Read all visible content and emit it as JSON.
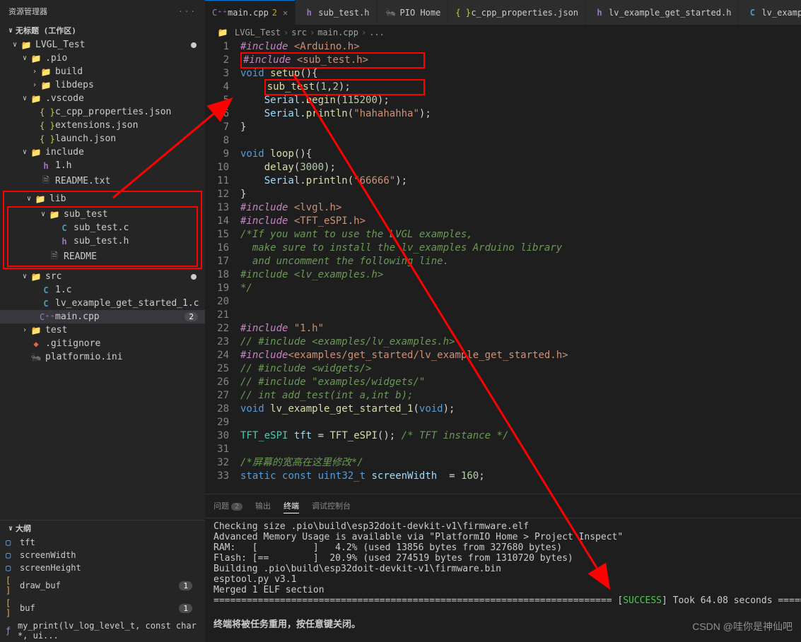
{
  "sidebar": {
    "title": "资源管理器",
    "workspace": "无标题 (工作区)",
    "tree": [
      {
        "indent": 1,
        "chev": "v",
        "icon": "folder-root",
        "label": "LVGL_Test",
        "dot": true
      },
      {
        "indent": 2,
        "chev": "v",
        "icon": "folder",
        "label": ".pio"
      },
      {
        "indent": 3,
        "chev": ">",
        "icon": "folder",
        "label": "build"
      },
      {
        "indent": 3,
        "chev": ">",
        "icon": "folder",
        "label": "libdeps"
      },
      {
        "indent": 2,
        "chev": "v",
        "icon": "folder",
        "label": ".vscode"
      },
      {
        "indent": 3,
        "chev": "",
        "icon": "json",
        "label": "c_cpp_properties.json"
      },
      {
        "indent": 3,
        "chev": "",
        "icon": "json",
        "label": "extensions.json"
      },
      {
        "indent": 3,
        "chev": "",
        "icon": "json",
        "label": "launch.json"
      },
      {
        "indent": 2,
        "chev": "v",
        "icon": "folder",
        "label": "include"
      },
      {
        "indent": 3,
        "chev": "",
        "icon": "h",
        "label": "1.h"
      },
      {
        "indent": 3,
        "chev": "",
        "icon": "txt",
        "label": "README.txt"
      },
      {
        "indent": 2,
        "chev": "v",
        "icon": "folder",
        "label": "lib",
        "redStart": true
      },
      {
        "indent": 3,
        "chev": "v",
        "icon": "folder",
        "label": "sub_test"
      },
      {
        "indent": 4,
        "chev": "",
        "icon": "c",
        "label": "sub_test.c"
      },
      {
        "indent": 4,
        "chev": "",
        "icon": "h",
        "label": "sub_test.h"
      },
      {
        "indent": 3,
        "chev": "",
        "icon": "txt",
        "label": "README",
        "redEnd": true
      },
      {
        "indent": 2,
        "chev": "v",
        "icon": "folder",
        "label": "src",
        "dot": true
      },
      {
        "indent": 3,
        "chev": "",
        "icon": "c",
        "label": "1.c"
      },
      {
        "indent": 3,
        "chev": "",
        "icon": "c",
        "label": "lv_example_get_started_1.c"
      },
      {
        "indent": 3,
        "chev": "",
        "icon": "cpp",
        "label": "main.cpp",
        "active": true,
        "badge": "2"
      },
      {
        "indent": 2,
        "chev": ">",
        "icon": "folder",
        "label": "test"
      },
      {
        "indent": 2,
        "chev": "",
        "icon": "git",
        "label": ".gitignore"
      },
      {
        "indent": 2,
        "chev": "",
        "icon": "pio",
        "label": "platformio.ini"
      }
    ],
    "outline_title": "大纲",
    "outline": [
      {
        "icon": "var",
        "label": "tft"
      },
      {
        "icon": "var",
        "label": "screenWidth"
      },
      {
        "icon": "var",
        "label": "screenHeight"
      },
      {
        "icon": "arr",
        "label": "draw_buf",
        "badge": "1"
      },
      {
        "icon": "arr",
        "label": "buf",
        "badge": "1"
      },
      {
        "icon": "fn",
        "label": "my_print(lv_log_level_t, const char *, ui..."
      }
    ]
  },
  "tabs": [
    {
      "icon": "cpp",
      "label": "main.cpp",
      "badge": "2",
      "close": true,
      "active": true
    },
    {
      "icon": "h",
      "label": "sub_test.h"
    },
    {
      "icon": "pio",
      "label": "PIO Home"
    },
    {
      "icon": "json",
      "label": "c_cpp_properties.json"
    },
    {
      "icon": "h",
      "label": "lv_example_get_started.h"
    },
    {
      "icon": "c",
      "label": "lv_example"
    }
  ],
  "breadcrumb": [
    "LVGL_Test",
    "src",
    "main.cpp",
    "..."
  ],
  "code_lines": [
    {
      "n": 1,
      "html": "<span class='k-include'>#include</span> <span class='k-string'>&lt;Arduino.h&gt;</span>"
    },
    {
      "n": 2,
      "html": "<span class='red-code-box'><span class='k-include'>#include</span> <span class='k-string'>&lt;sub_test.h&gt;</span>&nbsp;&nbsp;&nbsp;&nbsp;&nbsp;&nbsp;&nbsp;&nbsp;&nbsp;</span>"
    },
    {
      "n": 3,
      "html": "<span class='k-keyword'>void</span> <span class='k-func'>setup</span><span class='k-punct'>(){</span>"
    },
    {
      "n": 4,
      "html": "    <span class='red-code-box'><span class='k-func'>sub_test</span><span class='k-punct'>(</span><span class='k-num'>1</span><span class='k-punct'>,</span><span class='k-num'>2</span><span class='k-punct'>);</span>&nbsp;&nbsp;&nbsp;&nbsp;&nbsp;&nbsp;&nbsp;&nbsp;&nbsp;&nbsp;&nbsp;&nbsp;</span>"
    },
    {
      "n": 5,
      "html": "    <span class='k-var'>Serial</span><span class='k-punct'>.</span><span class='k-func'>begin</span><span class='k-punct'>(</span><span class='k-num'>115200</span><span class='k-punct'>);</span>"
    },
    {
      "n": 6,
      "html": "    <span class='k-var'>Serial</span><span class='k-punct'>.</span><span class='k-func'>println</span><span class='k-punct'>(</span><span class='k-string'>\"hahahahha\"</span><span class='k-punct'>);</span>"
    },
    {
      "n": 7,
      "html": "<span class='k-punct'>}</span>"
    },
    {
      "n": 8,
      "html": ""
    },
    {
      "n": 9,
      "html": "<span class='k-keyword'>void</span> <span class='k-func'>loop</span><span class='k-punct'>(){</span>"
    },
    {
      "n": 10,
      "html": "    <span class='k-func'>delay</span><span class='k-punct'>(</span><span class='k-num'>3000</span><span class='k-punct'>);</span>"
    },
    {
      "n": 11,
      "html": "    <span class='k-var'>Serial</span><span class='k-punct'>.</span><span class='k-func'>println</span><span class='k-punct'>(</span><span class='k-string'>\"66666\"</span><span class='k-punct'>);</span>"
    },
    {
      "n": 12,
      "html": "<span class='k-punct'>}</span>"
    },
    {
      "n": 13,
      "html": "<span class='k-include'>#include</span> <span class='k-string'>&lt;lvgl.h&gt;</span>"
    },
    {
      "n": 14,
      "html": "<span class='k-include'>#include</span> <span class='k-string'>&lt;TFT_eSPI.h&gt;</span>"
    },
    {
      "n": 15,
      "html": "<span class='k-comment'>/*If you want to use the LVGL examples,</span>"
    },
    {
      "n": 16,
      "html": "<span class='k-comment'>  make sure to install the lv_examples Arduino library</span>"
    },
    {
      "n": 17,
      "html": "<span class='k-comment'>  and uncomment the following line.</span>"
    },
    {
      "n": 18,
      "html": "<span class='k-comment'>#include &lt;lv_examples.h&gt;</span>"
    },
    {
      "n": 19,
      "html": "<span class='k-comment'>*/</span>"
    },
    {
      "n": 20,
      "html": ""
    },
    {
      "n": 21,
      "html": ""
    },
    {
      "n": 22,
      "html": "<span class='k-include'>#include</span> <span class='k-string'>\"1.h\"</span>"
    },
    {
      "n": 23,
      "html": "<span class='k-comment'>// #include &lt;examples/lv_examples.h&gt;</span>"
    },
    {
      "n": 24,
      "html": "<span class='k-include'>#include</span><span class='k-string'>&lt;examples/get_started/lv_example_get_started.h&gt;</span>"
    },
    {
      "n": 25,
      "html": "<span class='k-comment'>// #include &lt;widgets/&gt;</span>"
    },
    {
      "n": 26,
      "html": "<span class='k-comment'>// #include \"examples/widgets/\"</span>"
    },
    {
      "n": 27,
      "html": "<span class='k-comment'>// int add_test(int a,int b);</span>"
    },
    {
      "n": 28,
      "html": "<span class='k-keyword'>void</span> <span class='k-func'>lv_example_get_started_1</span><span class='k-punct'>(</span><span class='k-keyword'>void</span><span class='k-punct'>);</span>"
    },
    {
      "n": 29,
      "html": ""
    },
    {
      "n": 30,
      "html": "<span class='k-obj'>TFT_eSPI</span> <span class='k-var'>tft</span> <span class='k-punct'>=</span> <span class='k-func'>TFT_eSPI</span><span class='k-punct'>();</span> <span class='k-comment'>/* TFT instance */</span>"
    },
    {
      "n": 31,
      "html": ""
    },
    {
      "n": 32,
      "html": "<span class='k-comment'>/*屏幕的宽高在这里修改*/</span>"
    },
    {
      "n": 33,
      "html": "<span class='k-keyword'>static</span> <span class='k-keyword'>const</span> <span class='k-type'>uint32_t</span> <span class='k-var'>screenWidth</span>  <span class='k-punct'>=</span> <span class='k-num'>160</span><span class='k-punct'>;</span>"
    }
  ],
  "terminal": {
    "tabs": [
      {
        "label": "问题",
        "badge": "2"
      },
      {
        "label": "输出"
      },
      {
        "label": "终端",
        "active": true
      },
      {
        "label": "调试控制台"
      }
    ],
    "lines": [
      "Checking size .pio\\build\\esp32doit-devkit-v1\\firmware.elf",
      "Advanced Memory Usage is available via \"PlatformIO Home > Project Inspect\"",
      "RAM:   [          ]   4.2% (used 13856 bytes from 327680 bytes)",
      "Flash: [==        ]  20.9% (used 274519 bytes from 1310720 bytes)",
      "Building .pio\\build\\esp32doit-devkit-v1\\firmware.bin",
      "esptool.py v3.1",
      "Merged 1 ELF section"
    ],
    "success_line": "======================================================================== [SUCCESS] Took 64.08 seconds =====",
    "close_hint": "终端将被任务重用，按任意键关闭。"
  },
  "watermark": "CSDN @哇你是神仙吧"
}
